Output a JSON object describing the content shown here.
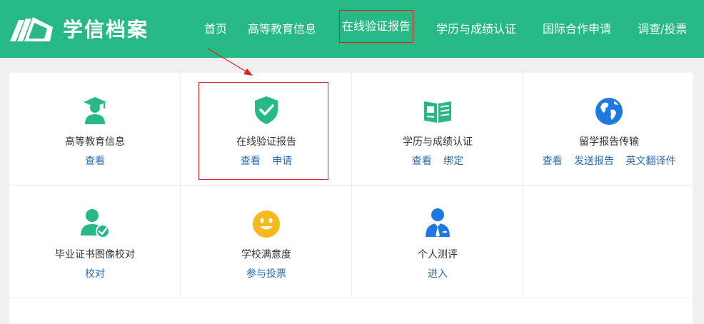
{
  "header": {
    "brand": "学信档案",
    "nav": [
      {
        "label": "首页"
      },
      {
        "label": "高等教育信息"
      },
      {
        "label": "在线验证报告"
      },
      {
        "label": "学历与成绩认证"
      },
      {
        "label": "国际合作申请"
      },
      {
        "label": "调查/投票"
      }
    ]
  },
  "services": [
    {
      "title": "高等教育信息",
      "icon": "graduate-icon",
      "links": [
        "查看"
      ]
    },
    {
      "title": "在线验证报告",
      "icon": "shield-check-icon",
      "links": [
        "查看",
        "申请"
      ]
    },
    {
      "title": "学历与成绩认证",
      "icon": "certificate-book-icon",
      "links": [
        "查看",
        "绑定"
      ]
    },
    {
      "title": "留学报告传输",
      "icon": "globe-icon",
      "links": [
        "查看",
        "发送报告",
        "英文翻译件"
      ]
    },
    {
      "title": "毕业证书图像校对",
      "icon": "user-check-icon",
      "links": [
        "校对"
      ]
    },
    {
      "title": "学校满意度",
      "icon": "smiley-icon",
      "links": [
        "参与投票"
      ]
    },
    {
      "title": "个人测评",
      "icon": "person-tie-icon",
      "links": [
        "进入"
      ]
    }
  ],
  "colors": {
    "brand": "#26b985",
    "link": "#2a6bb5",
    "highlight": "#d62222",
    "globe": "#1e7ae0",
    "smiley": "#f6b81a"
  }
}
